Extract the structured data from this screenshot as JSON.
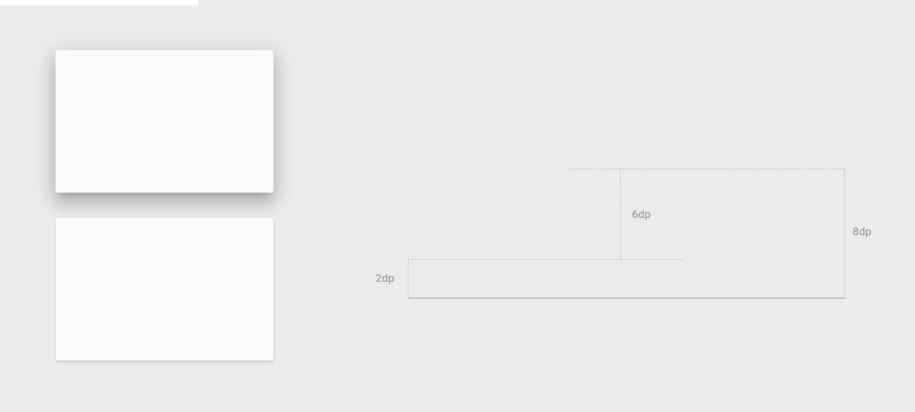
{
  "labels": {
    "two_dp": "2dp",
    "six_dp": "6dp",
    "eight_dp": "8dp"
  }
}
